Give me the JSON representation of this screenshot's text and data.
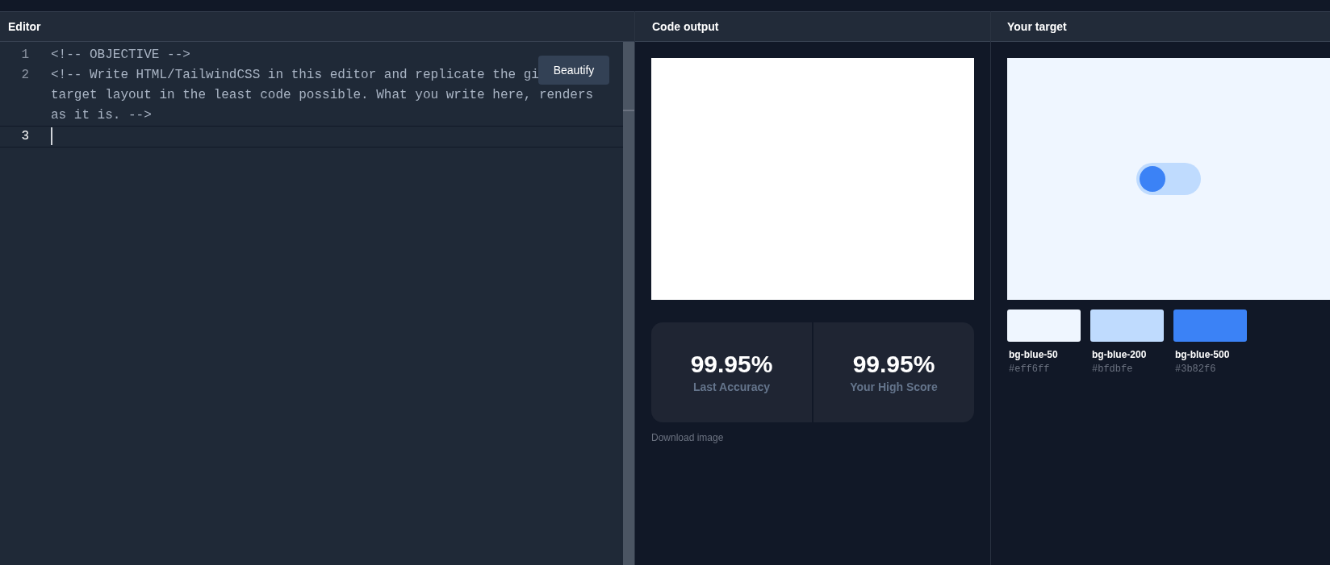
{
  "editor": {
    "title": "Editor",
    "lines": [
      {
        "number": "1",
        "rows": [
          "<!-- OBJECTIVE -->"
        ],
        "active": false
      },
      {
        "number": "2",
        "rows": [
          "<!-- Write HTML/TailwindCSS in this editor and replicate the gi",
          "target layout in the least code possible. What you write here, renders",
          "as it is. -->"
        ],
        "active": false
      },
      {
        "number": "3",
        "active": true
      }
    ],
    "beautify_button": "Beautify"
  },
  "output": {
    "title": "Code output",
    "stats": [
      {
        "value": "99.95%",
        "label": "Last Accuracy"
      },
      {
        "value": "99.95%",
        "label": "Your High Score"
      }
    ],
    "download_link": "Download image"
  },
  "target": {
    "title": "Your target",
    "toggle": {
      "on": false
    },
    "swatches": [
      {
        "name": "bg-blue-50",
        "hex": "#eff6ff",
        "color": "#eff6ff"
      },
      {
        "name": "bg-blue-200",
        "hex": "#bfdbfe",
        "color": "#bfdbfe"
      },
      {
        "name": "bg-blue-500",
        "hex": "#3b82f6",
        "color": "#3b82f6"
      }
    ]
  }
}
